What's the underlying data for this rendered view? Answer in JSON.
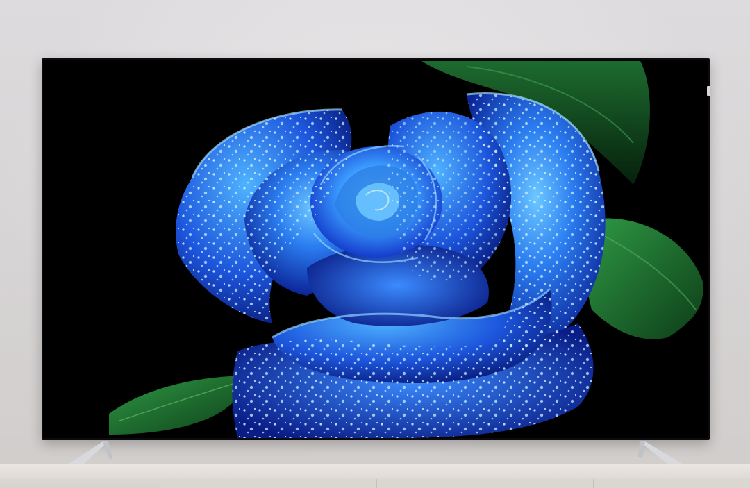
{
  "scene": {
    "subject": "blue-rose",
    "colors": {
      "wall": "#e3e0e1",
      "tv_bezel": "#0b0b0d",
      "rose_light": "#3fa8ff",
      "rose_mid": "#1f5fe0",
      "rose_dark": "#0a1f8a",
      "leaf": "#1f7a34",
      "cabinet": "#dcd6d1"
    }
  }
}
